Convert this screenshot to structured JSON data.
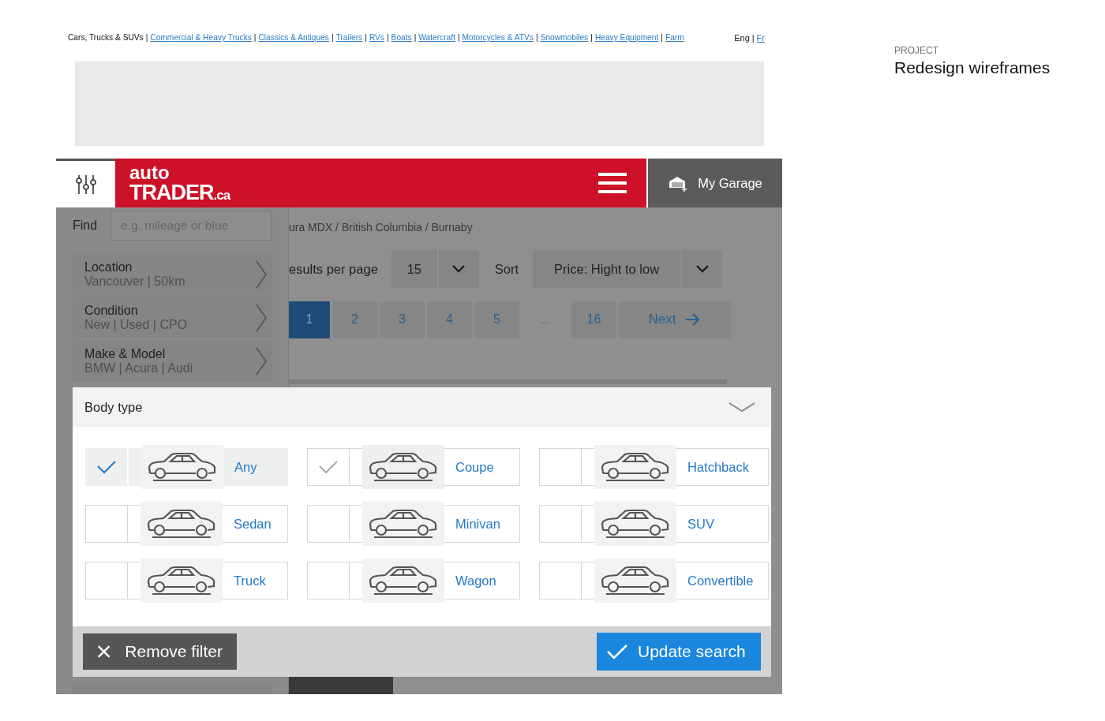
{
  "top_links": {
    "items": [
      {
        "kind": "current",
        "text": "Cars, Trucks & SUVs"
      },
      {
        "kind": "separator",
        "text": "|"
      },
      {
        "kind": "link",
        "text": "Commercial & Heavy Trucks"
      },
      {
        "kind": "separator",
        "text": "|"
      },
      {
        "kind": "link",
        "text": "Classics & Antiques"
      },
      {
        "kind": "separator",
        "text": "|"
      },
      {
        "kind": "link",
        "text": "Trailers"
      },
      {
        "kind": "separator",
        "text": "|"
      },
      {
        "kind": "link",
        "text": "RVs"
      },
      {
        "kind": "separator",
        "text": "|"
      },
      {
        "kind": "link",
        "text": "Boats"
      },
      {
        "kind": "separator",
        "text": "|"
      },
      {
        "kind": "link",
        "text": "Watercraft"
      },
      {
        "kind": "separator",
        "text": "|"
      },
      {
        "kind": "link",
        "text": "Motorcycles & ATVs"
      },
      {
        "kind": "separator",
        "text": "|"
      },
      {
        "kind": "link",
        "text": "Snowmobiles"
      },
      {
        "kind": "separator",
        "text": "|"
      },
      {
        "kind": "link",
        "text": "Heavy Equipment"
      },
      {
        "kind": "separator",
        "text": "|"
      },
      {
        "kind": "link",
        "text": "Farm"
      }
    ],
    "languages": [
      {
        "kind": "language",
        "text": "Eng",
        "selected": true
      },
      {
        "kind": "separator",
        "text": "|"
      },
      {
        "kind": "language",
        "text": "Fr",
        "selected": false
      }
    ]
  },
  "project": {
    "label": "PROJECT",
    "title": "Redesign wireframes"
  },
  "header": {
    "logo_top": "auto",
    "logo_main": "TRADER",
    "logo_suffix": ".ca",
    "garage": "My Garage"
  },
  "sidebar": {
    "find_label": "Find",
    "find_placeholder": "e.g. mileage or blue",
    "filters": [
      {
        "title": "Location",
        "value": "Vancouver | 50km"
      },
      {
        "title": "Condition",
        "value": "New | Used | CPO"
      },
      {
        "title": "Make & Model",
        "value": "BMW | Acura | Audi"
      }
    ]
  },
  "breadcrumb": "ura MDX / British Columbia / Burnaby",
  "results": {
    "label": "esults per page",
    "per_page": "15",
    "sort_label": "Sort",
    "sort": "Price: Hight to low"
  },
  "pagination": {
    "pages": [
      {
        "label": "1",
        "selected": true
      },
      {
        "label": "2",
        "selected": false
      },
      {
        "label": "3",
        "selected": false
      },
      {
        "label": "4",
        "selected": false
      },
      {
        "label": "5",
        "selected": false
      }
    ],
    "ellipsis": "...",
    "last": "16",
    "next": "Next"
  },
  "body_type": {
    "title": "Body type",
    "options": [
      {
        "label": "Any",
        "checked": true,
        "hovered": false
      },
      {
        "label": "Coupe",
        "checked": false,
        "hovered": true
      },
      {
        "label": "Hatchback",
        "checked": false,
        "hovered": false
      },
      {
        "label": "Sedan",
        "checked": false,
        "hovered": false
      },
      {
        "label": "Minivan",
        "checked": false,
        "hovered": false
      },
      {
        "label": "SUV",
        "checked": false,
        "hovered": false
      },
      {
        "label": "Truck",
        "checked": false,
        "hovered": false
      },
      {
        "label": "Wagon",
        "checked": false,
        "hovered": false
      },
      {
        "label": "Convertible",
        "checked": false,
        "hovered": false
      }
    ],
    "remove": "Remove filter",
    "update": "Update search"
  }
}
